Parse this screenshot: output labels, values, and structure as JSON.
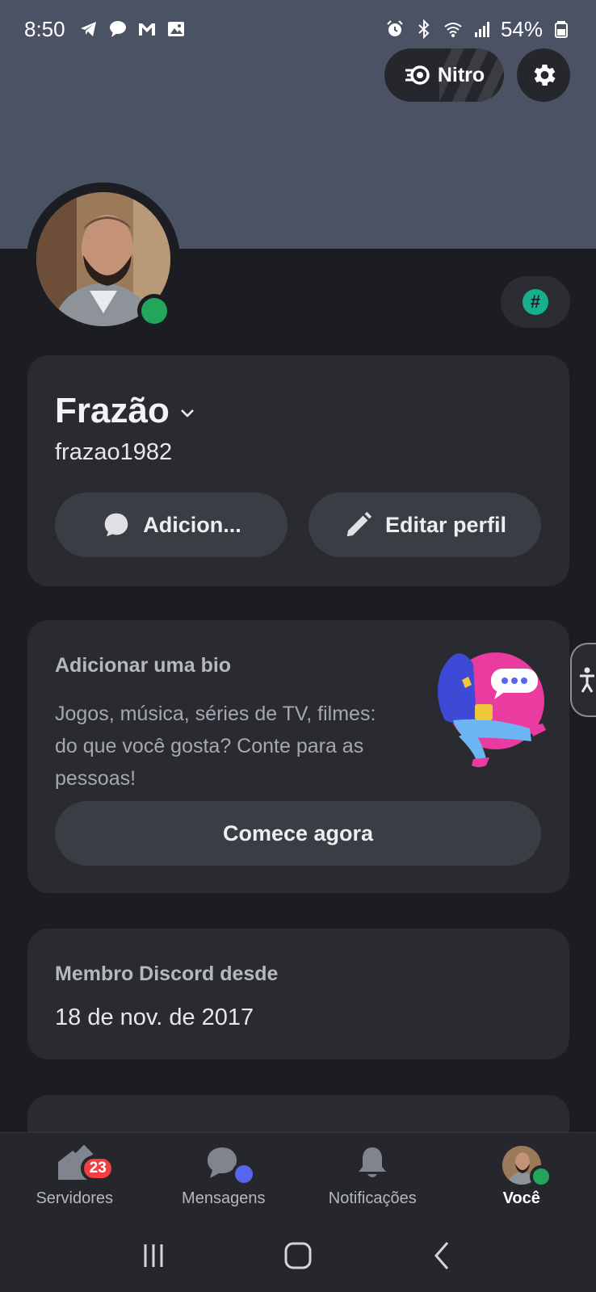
{
  "status_bar": {
    "time": "8:50",
    "battery": "54%",
    "left_icons": [
      "telegram-icon",
      "chat-bubble-icon",
      "gmail-icon",
      "gallery-icon"
    ],
    "right_icons": [
      "alarm-icon",
      "bluetooth-icon",
      "wifi-icon",
      "signal-icon",
      "battery-icon"
    ]
  },
  "header": {
    "nitro_label": "Nitro",
    "settings_icon": "gear-icon",
    "banner_color": "#4a5263"
  },
  "profile": {
    "display_name": "Frazão",
    "username": "frazao1982",
    "status": "online",
    "status_color": "#23a55a",
    "add_button_label": "Adicion...",
    "edit_button_label": "Editar perfil"
  },
  "bio": {
    "title": "Adicionar uma bio",
    "text": "Jogos, música, séries de TV, filmes: do que você gosta? Conte para as pessoas!",
    "button_label": "Comece agora"
  },
  "member": {
    "title": "Membro Discord desde",
    "date": "18 de nov. de 2017"
  },
  "bottom_nav": {
    "items": [
      {
        "label": "Servidores",
        "icon": "servers-icon",
        "badge": "23"
      },
      {
        "label": "Mensagens",
        "icon": "messages-icon"
      },
      {
        "label": "Notificações",
        "icon": "bell-icon"
      },
      {
        "label": "Você",
        "icon": "avatar",
        "active": true
      }
    ]
  },
  "colors": {
    "accent": "#5865f2",
    "badge": "#f23f43",
    "online": "#23a55a"
  }
}
